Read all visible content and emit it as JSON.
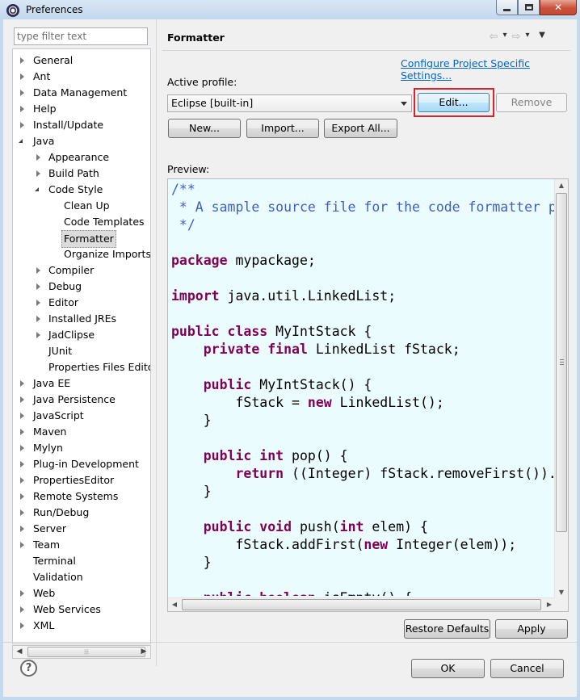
{
  "window": {
    "title": "Preferences"
  },
  "filter": {
    "placeholder": "type filter text"
  },
  "tree": [
    {
      "label": "General",
      "level": 0,
      "state": "closed"
    },
    {
      "label": "Ant",
      "level": 0,
      "state": "closed"
    },
    {
      "label": "Data Management",
      "level": 0,
      "state": "closed"
    },
    {
      "label": "Help",
      "level": 0,
      "state": "closed"
    },
    {
      "label": "Install/Update",
      "level": 0,
      "state": "closed"
    },
    {
      "label": "Java",
      "level": 0,
      "state": "open"
    },
    {
      "label": "Appearance",
      "level": 1,
      "state": "closed"
    },
    {
      "label": "Build Path",
      "level": 1,
      "state": "closed"
    },
    {
      "label": "Code Style",
      "level": 1,
      "state": "open"
    },
    {
      "label": "Clean Up",
      "level": 2,
      "state": "leaf"
    },
    {
      "label": "Code Templates",
      "level": 2,
      "state": "leaf"
    },
    {
      "label": "Formatter",
      "level": 2,
      "state": "leaf",
      "selected": true
    },
    {
      "label": "Organize Imports",
      "level": 2,
      "state": "leaf"
    },
    {
      "label": "Compiler",
      "level": 1,
      "state": "closed"
    },
    {
      "label": "Debug",
      "level": 1,
      "state": "closed"
    },
    {
      "label": "Editor",
      "level": 1,
      "state": "closed"
    },
    {
      "label": "Installed JREs",
      "level": 1,
      "state": "closed"
    },
    {
      "label": "JadClipse",
      "level": 1,
      "state": "closed"
    },
    {
      "label": "JUnit",
      "level": 1,
      "state": "leaf"
    },
    {
      "label": "Properties Files Edito",
      "level": 1,
      "state": "leaf"
    },
    {
      "label": "Java EE",
      "level": 0,
      "state": "closed"
    },
    {
      "label": "Java Persistence",
      "level": 0,
      "state": "closed"
    },
    {
      "label": "JavaScript",
      "level": 0,
      "state": "closed"
    },
    {
      "label": "Maven",
      "level": 0,
      "state": "closed"
    },
    {
      "label": "Mylyn",
      "level": 0,
      "state": "closed"
    },
    {
      "label": "Plug-in Development",
      "level": 0,
      "state": "closed"
    },
    {
      "label": "PropertiesEditor",
      "level": 0,
      "state": "closed"
    },
    {
      "label": "Remote Systems",
      "level": 0,
      "state": "closed"
    },
    {
      "label": "Run/Debug",
      "level": 0,
      "state": "closed"
    },
    {
      "label": "Server",
      "level": 0,
      "state": "closed"
    },
    {
      "label": "Team",
      "level": 0,
      "state": "closed"
    },
    {
      "label": "Terminal",
      "level": 0,
      "state": "leaf"
    },
    {
      "label": "Validation",
      "level": 0,
      "state": "leaf"
    },
    {
      "label": "Web",
      "level": 0,
      "state": "closed"
    },
    {
      "label": "Web Services",
      "level": 0,
      "state": "closed"
    },
    {
      "label": "XML",
      "level": 0,
      "state": "closed"
    }
  ],
  "page": {
    "title": "Formatter",
    "configure_link": "Configure Project Specific Settings...",
    "active_profile_label": "Active profile:",
    "profile_value": "Eclipse [built-in]",
    "edit_label": "Edit...",
    "remove_label": "Remove",
    "new_label": "New...",
    "import_label": "Import...",
    "export_label": "Export All...",
    "preview_label": "Preview:"
  },
  "code": [
    [
      [
        "cm",
        "/**"
      ]
    ],
    [
      [
        "cm",
        " * A sample source file for the code formatter preview"
      ]
    ],
    [
      [
        "cm",
        " */"
      ]
    ],
    [],
    [
      [
        "kw",
        "package"
      ],
      [
        "",
        " mypackage;"
      ]
    ],
    [],
    [
      [
        "kw",
        "import"
      ],
      [
        "",
        " java.util.LinkedList;"
      ]
    ],
    [],
    [
      [
        "kw",
        "public"
      ],
      [
        "",
        " "
      ],
      [
        "kw",
        "class"
      ],
      [
        "",
        " MyIntStack {"
      ]
    ],
    [
      [
        "",
        "    "
      ],
      [
        "kw",
        "private"
      ],
      [
        "",
        " "
      ],
      [
        "kw",
        "final"
      ],
      [
        "",
        " LinkedList fStack;"
      ]
    ],
    [],
    [
      [
        "",
        "    "
      ],
      [
        "kw",
        "public"
      ],
      [
        "",
        " MyIntStack() {"
      ]
    ],
    [
      [
        "",
        "        fStack = "
      ],
      [
        "kw",
        "new"
      ],
      [
        "",
        " LinkedList();"
      ]
    ],
    [
      [
        "",
        "    }"
      ]
    ],
    [],
    [
      [
        "",
        "    "
      ],
      [
        "kw",
        "public"
      ],
      [
        "",
        " "
      ],
      [
        "kw",
        "int"
      ],
      [
        "",
        " pop() {"
      ]
    ],
    [
      [
        "",
        "        "
      ],
      [
        "kw",
        "return"
      ],
      [
        "",
        " ((Integer) fStack.removeFirst()).intValue();"
      ]
    ],
    [
      [
        "",
        "    }"
      ]
    ],
    [],
    [
      [
        "",
        "    "
      ],
      [
        "kw",
        "public"
      ],
      [
        "",
        " "
      ],
      [
        "kw",
        "void"
      ],
      [
        "",
        " push("
      ],
      [
        "kw",
        "int"
      ],
      [
        "",
        " elem) {"
      ]
    ],
    [
      [
        "",
        "        fStack.addFirst("
      ],
      [
        "kw",
        "new"
      ],
      [
        "",
        " Integer(elem));"
      ]
    ],
    [
      [
        "",
        "    }"
      ]
    ],
    [],
    [
      [
        "",
        "    "
      ],
      [
        "kw",
        "public"
      ],
      [
        "",
        " "
      ],
      [
        "kw",
        "boolean"
      ],
      [
        "",
        " isEmpty() {"
      ]
    ]
  ],
  "footer": {
    "restore_label": "Restore Defaults",
    "apply_label": "Apply",
    "ok_label": "OK",
    "cancel_label": "Cancel"
  }
}
